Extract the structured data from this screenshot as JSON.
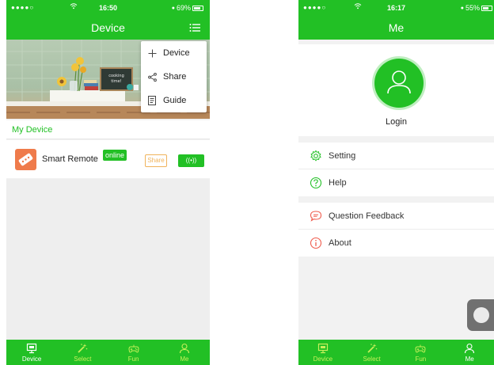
{
  "colors": {
    "accent": "#22c025",
    "tab_inactive": "#c7f05a",
    "share_border": "#f0b35b",
    "device_icon": "#ef7b4b"
  },
  "left": {
    "status": {
      "signal": "●●●●○",
      "time": "16:50",
      "battery": "69%",
      "battery_level": 0.69
    },
    "nav_title": "Device",
    "menu_icon": "list-icon",
    "banner_text": "cooking time!",
    "popup": [
      {
        "icon": "plus-icon",
        "label": "Device"
      },
      {
        "icon": "share-icon",
        "label": "Share"
      },
      {
        "icon": "document-icon",
        "label": "Guide"
      }
    ],
    "section_label": "My Device",
    "device": {
      "name": "Smart Remote",
      "status": "online",
      "share_label": "Share",
      "signal_label": "((•))"
    }
  },
  "right": {
    "status": {
      "signal": "●●●●○",
      "time": "16:17",
      "battery": "55%",
      "battery_level": 0.55
    },
    "nav_title": "Me",
    "login_label": "Login",
    "menu_group_1": [
      {
        "icon": "gear-icon",
        "label": "Setting"
      },
      {
        "icon": "help-icon",
        "label": "Help"
      }
    ],
    "menu_group_2": [
      {
        "icon": "chat-icon",
        "label": "Question Feedback"
      },
      {
        "icon": "info-icon",
        "label": "About"
      }
    ]
  },
  "tabs": [
    {
      "icon": "monitor-icon",
      "label": "Device"
    },
    {
      "icon": "wand-icon",
      "label": "Select"
    },
    {
      "icon": "gamepad-icon",
      "label": "Fun"
    },
    {
      "icon": "person-icon",
      "label": "Me"
    }
  ]
}
